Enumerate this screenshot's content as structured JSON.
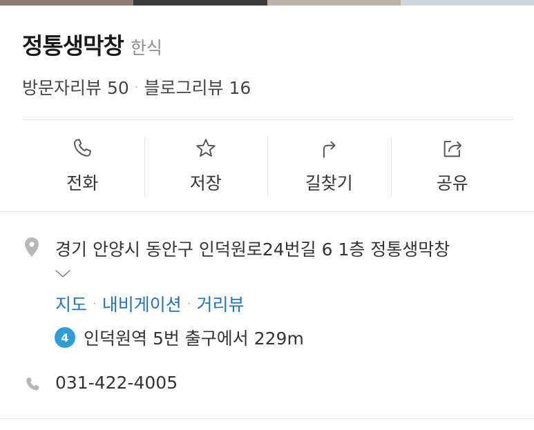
{
  "place": {
    "name": "정통생막창",
    "category": "한식"
  },
  "reviews": {
    "visitor": "방문자리뷰 50",
    "blog": "블로그리뷰 16",
    "separator": "·"
  },
  "actions": [
    {
      "label": "전화",
      "icon": "phone-icon"
    },
    {
      "label": "저장",
      "icon": "star-icon"
    },
    {
      "label": "길찾기",
      "icon": "directions-arrow-icon"
    },
    {
      "label": "공유",
      "icon": "share-icon"
    }
  ],
  "address": {
    "text": "경기 안양시 동안구 인덕원로24번길 6 1층 정통생막창",
    "icon": "location-pin-icon"
  },
  "links": {
    "map": "지도",
    "navigation": "내비게이션",
    "street_view": "거리뷰",
    "separator": "·"
  },
  "subway": {
    "line": "4",
    "line_color": "#2c9fdb",
    "text": "인덕원역 5번 출구에서 229m"
  },
  "phone": {
    "number": "031-422-4005",
    "icon": "phone-icon"
  },
  "colors": {
    "link": "#1f73c4",
    "icon": "#555555",
    "muted": "#8e8e8e"
  }
}
